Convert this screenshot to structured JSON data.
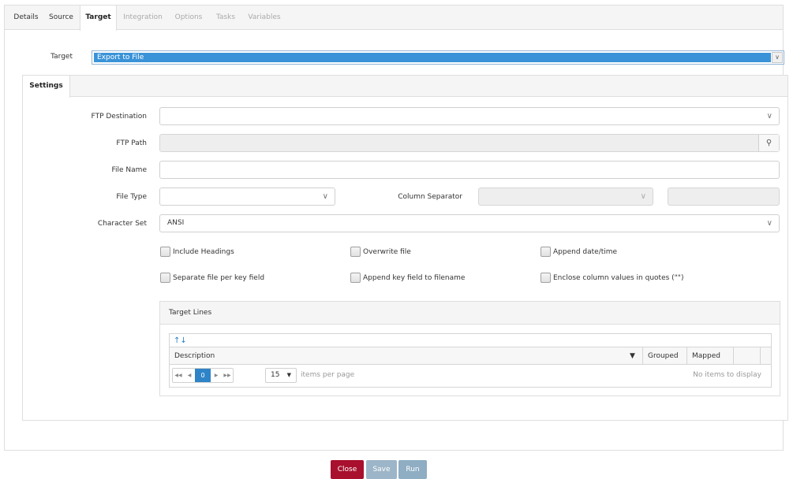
{
  "tabs": [
    {
      "label": "Details",
      "state": "enabled"
    },
    {
      "label": "Source",
      "state": "enabled"
    },
    {
      "label": "Target",
      "state": "active"
    },
    {
      "label": "Integration",
      "state": "disabled"
    },
    {
      "label": "Options",
      "state": "disabled"
    },
    {
      "label": "Tasks",
      "state": "disabled"
    },
    {
      "label": "Variables",
      "state": "disabled"
    }
  ],
  "target": {
    "label": "Target",
    "value": "Export to File"
  },
  "settings": {
    "tab_label": "Settings",
    "ftp_destination": {
      "label": "FTP Destination",
      "value": ""
    },
    "ftp_path": {
      "label": "FTP Path",
      "value": ""
    },
    "file_name": {
      "label": "File Name",
      "value": ""
    },
    "file_type": {
      "label": "File Type",
      "value": ""
    },
    "column_separator": {
      "label": "Column Separator",
      "value": "",
      "custom_value": ""
    },
    "character_set": {
      "label": "Character Set",
      "value": "ANSI"
    },
    "checkboxes": [
      {
        "label": "Include Headings",
        "checked": false
      },
      {
        "label": "Overwrite file",
        "checked": false
      },
      {
        "label": "Append date/time",
        "checked": false
      },
      {
        "label": "Separate file per key field",
        "checked": false
      },
      {
        "label": "Append key field to filename",
        "checked": false
      },
      {
        "label": "Enclose column values in quotes (\"\")",
        "checked": false
      }
    ]
  },
  "target_lines": {
    "title": "Target Lines",
    "columns": [
      "Description",
      "Grouped",
      "Mapped"
    ],
    "pager": {
      "current_page": "0",
      "page_size": "15",
      "page_size_label": "items per page",
      "empty_message": "No items to display"
    }
  },
  "footer": {
    "close": "Close",
    "save": "Save",
    "run": "Run"
  },
  "colors": {
    "primary": "#3a93d8",
    "danger": "#a8102e",
    "muted_button": "#9db5c8"
  }
}
